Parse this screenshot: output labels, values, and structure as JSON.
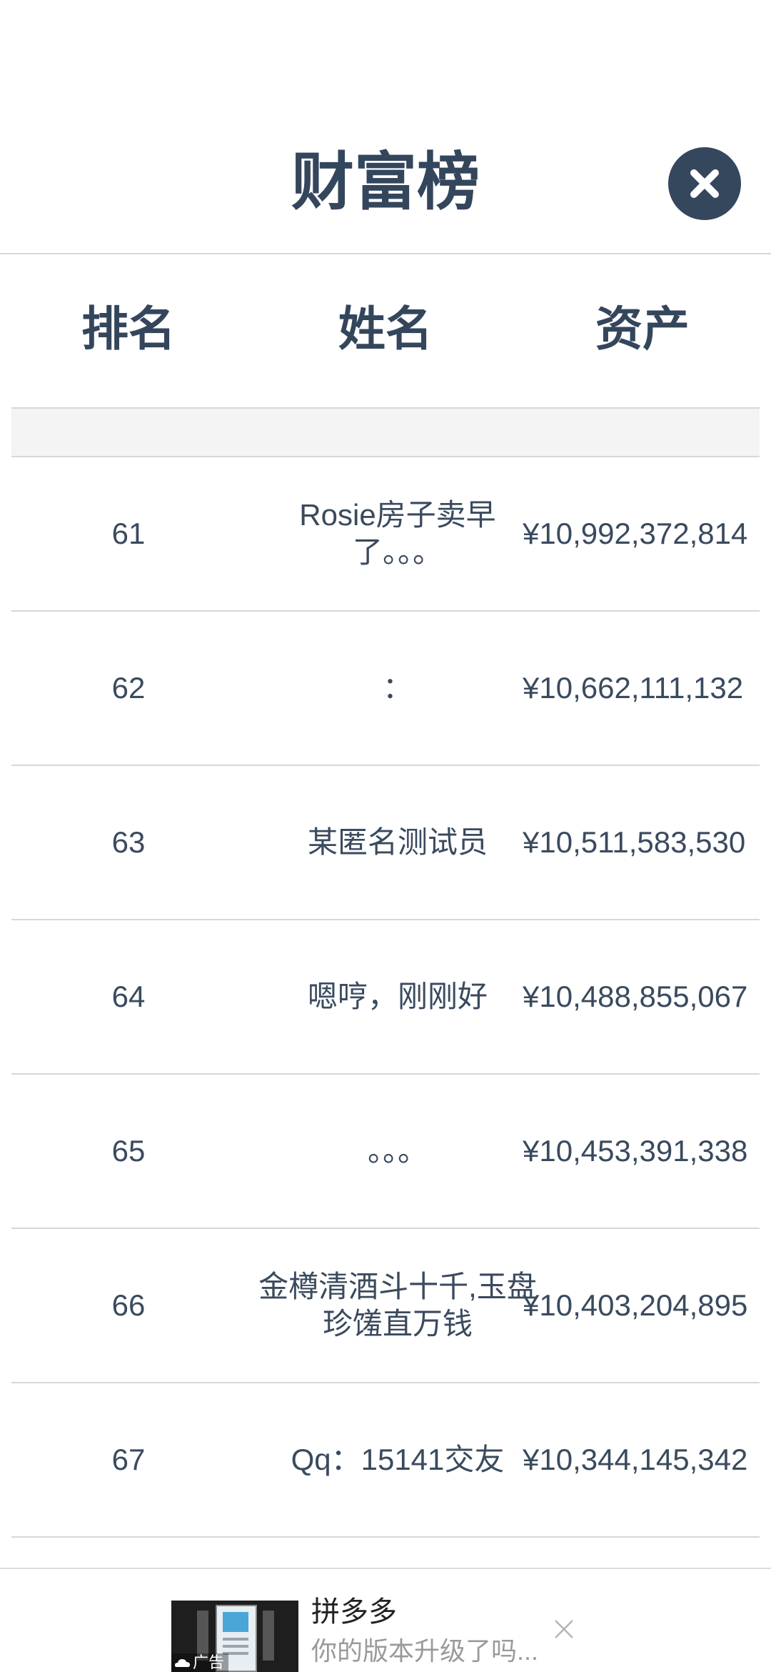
{
  "modal": {
    "title": "财富榜"
  },
  "table": {
    "headers": {
      "rank": "排名",
      "name": "姓名",
      "assets": "资产"
    },
    "rows": [
      {
        "rank": "61",
        "name": "Rosie房子卖早了。。。",
        "assets": "¥10,992,372,814"
      },
      {
        "rank": "62",
        "name": "：",
        "assets": "¥10,662,111,132"
      },
      {
        "rank": "63",
        "name": "某匿名测试员",
        "assets": "¥10,511,583,530"
      },
      {
        "rank": "64",
        "name": "嗯哼，刚刚好",
        "assets": "¥10,488,855,067"
      },
      {
        "rank": "65",
        "name": "。。。",
        "assets": "¥10,453,391,338"
      },
      {
        "rank": "66",
        "name": "金樽清酒斗十千,玉盘珍馐直万钱",
        "assets": "¥10,403,204,895"
      },
      {
        "rank": "67",
        "name": "Qq：15141交友",
        "assets": "¥10,344,145,342"
      }
    ]
  },
  "ad": {
    "tag": "广告",
    "title": "拼多多",
    "description": "你的版本升级了吗..."
  },
  "icons": {
    "close": "close-icon",
    "ad_close": "close-icon"
  },
  "colors": {
    "primary": "#35475d",
    "text": "#3a4a5e",
    "divider": "#d7d7d7",
    "band": "#f4f4f4"
  }
}
